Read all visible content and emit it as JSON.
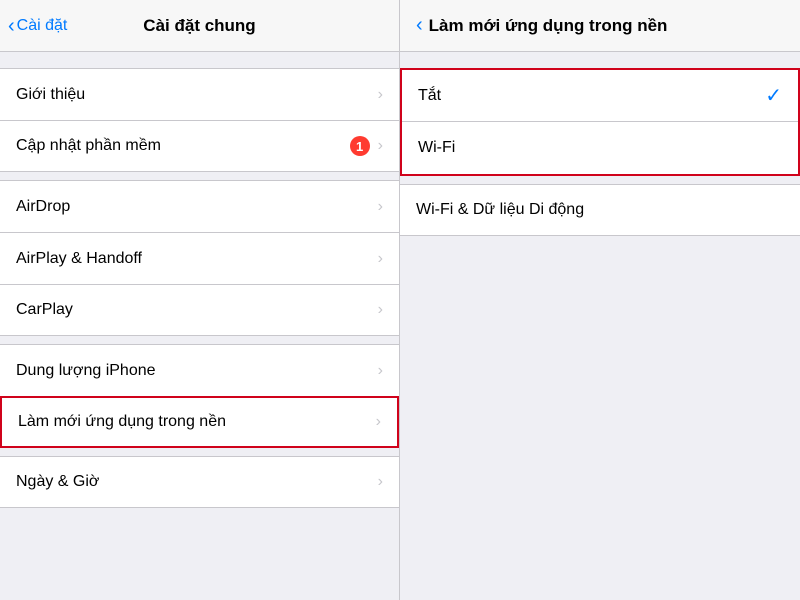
{
  "left": {
    "nav": {
      "back_label": "Cài đặt",
      "title": "Cài đặt chung"
    },
    "group1": [
      {
        "id": "gioi-thieu",
        "label": "Giới thiệu",
        "badge": null
      },
      {
        "id": "cap-nhat",
        "label": "Cập nhật phần mềm",
        "badge": "1"
      }
    ],
    "group2": [
      {
        "id": "airdrop",
        "label": "AirDrop",
        "badge": null
      },
      {
        "id": "airplay",
        "label": "AirPlay & Handoff",
        "badge": null
      },
      {
        "id": "carplay",
        "label": "CarPlay",
        "badge": null
      }
    ],
    "group3": [
      {
        "id": "dung-luong",
        "label": "Dung lượng iPhone",
        "badge": null
      },
      {
        "id": "lam-moi",
        "label": "Làm mới ứng dụng trong nền",
        "badge": null,
        "highlighted": true
      }
    ],
    "group4": [
      {
        "id": "ngay-gio",
        "label": "Ngày & Giờ",
        "badge": null
      }
    ]
  },
  "right": {
    "nav": {
      "title": "Làm mới ứng dụng trong nền"
    },
    "options_boxed": [
      {
        "id": "tat",
        "label": "Tắt",
        "checked": true
      },
      {
        "id": "wifi",
        "label": "Wi-Fi",
        "checked": false
      }
    ],
    "option_plain": {
      "id": "wifi-data",
      "label": "Wi-Fi & Dữ liệu Di động"
    }
  },
  "icons": {
    "chevron": "›",
    "back": "‹",
    "check": "✓"
  }
}
